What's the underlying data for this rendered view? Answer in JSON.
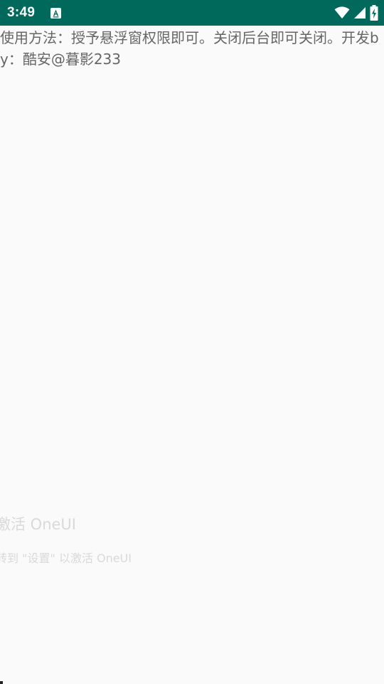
{
  "status_bar": {
    "time": "3:49",
    "background_color": "#00695c",
    "notification_icon": "app-notification-a-icon",
    "icons": [
      "wifi-icon",
      "cellular-signal-icon",
      "battery-charging-icon"
    ]
  },
  "main": {
    "usage_text": "使用方法：授予悬浮窗权限即可。关闭后台即可关闭。开发by：酷安@暮影233"
  },
  "overlay": {
    "title": "激活 OneUI",
    "subtitle": "转到 \"设置\" 以激活 OneUI"
  }
}
